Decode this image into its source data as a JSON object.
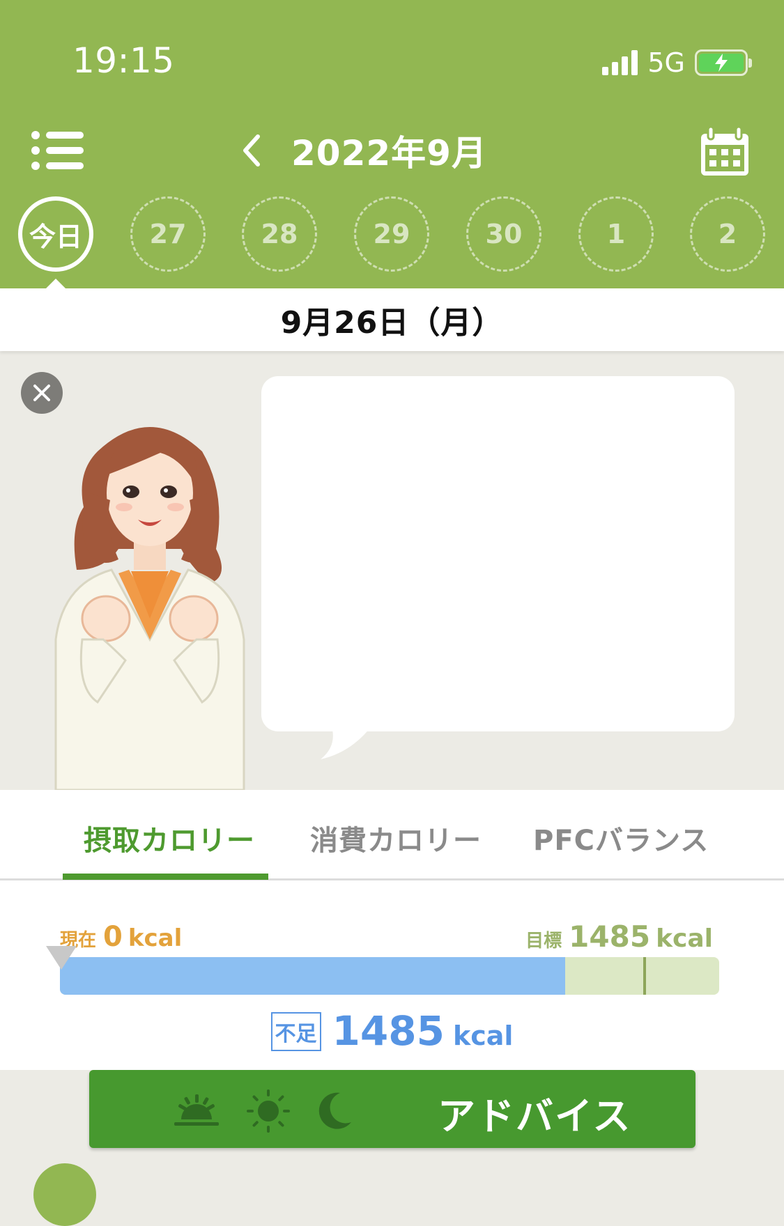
{
  "status_bar": {
    "time": "19:15",
    "network": "5G",
    "battery_level": 1.0
  },
  "header": {
    "month_title": "2022年9月",
    "icons": [
      "list-menu-icon",
      "chevron-left-icon",
      "calendar-icon"
    ]
  },
  "day_strip": {
    "today_label": "今日",
    "days": [
      "27",
      "28",
      "29",
      "30",
      "1",
      "2"
    ]
  },
  "selected_date": "9月26日（月）",
  "tabs": [
    {
      "label": "摂取カロリー",
      "active": true
    },
    {
      "label": "消費カロリー",
      "active": false
    },
    {
      "label": "PFCバランス",
      "active": false
    }
  ],
  "calories": {
    "current_caption": "現在",
    "current_value": "0",
    "current_unit": "kcal",
    "target_caption": "目標",
    "target_value": "1485",
    "target_unit": "kcal",
    "shortage_badge": "不足",
    "shortage_value": "1485",
    "shortage_unit": "kcal",
    "blue_fill_fraction": 0.766,
    "target_marker_fraction": 0.885
  },
  "advice_button": {
    "label": "アドバイス",
    "icons": [
      "sunrise-icon",
      "sun-icon",
      "moon-icon"
    ]
  },
  "colors": {
    "header_green": "#92b752",
    "active_tab": "#4e9a2f",
    "advice_button": "#47992f",
    "current_orange": "#e3a23b",
    "shortage_blue": "#5694e3",
    "progress_blue": "#8cbff2"
  }
}
